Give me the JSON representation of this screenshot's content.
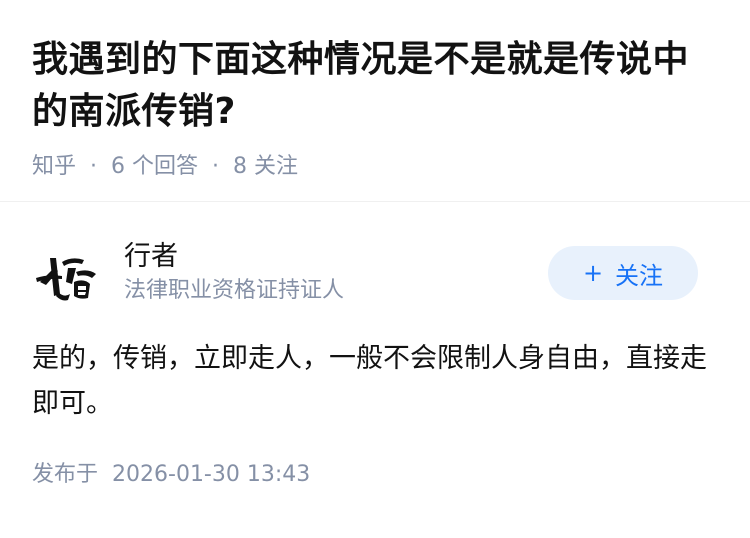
{
  "question": {
    "title": "我遇到的下面这种情况是不是就是传说中的南派传销?",
    "site": "知乎",
    "answers_count": "6 个回答",
    "followers_count": "8 关注"
  },
  "answer": {
    "author": {
      "name": "行者",
      "headline": "法律职业资格证持证人",
      "avatar_icon": "calligraphy-avatar-icon"
    },
    "follow_label": "关注",
    "follow_icon": "plus-icon",
    "content": "是的，传销，立即走人，一般不会限制人身自由，直接走即可。",
    "publish_label": "发布于",
    "publish_time": "2026-01-30 13:43"
  },
  "colors": {
    "primary_text": "#121212",
    "meta_text": "#8590a6",
    "follow_bg": "#e8f1fc",
    "follow_text": "#1772f6"
  }
}
